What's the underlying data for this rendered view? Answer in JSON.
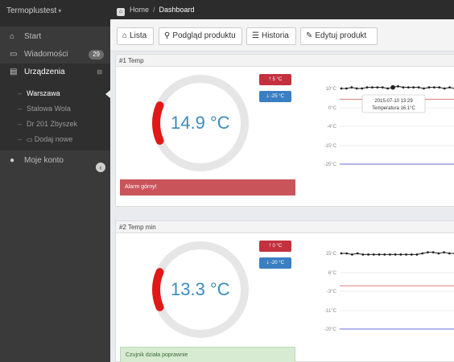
{
  "app": {
    "brand": "Termoplustest",
    "caret": "▾"
  },
  "sidebar": {
    "items": [
      {
        "label": "Start",
        "icon": "home-icon"
      },
      {
        "label": "Wiadomości",
        "icon": "inbox-icon",
        "badge": "29"
      },
      {
        "label": "Urządzenia",
        "icon": "devices-icon",
        "toggle": "⊟"
      }
    ],
    "subitems": [
      {
        "label": "Warszawa"
      },
      {
        "label": "Stalowa Wola"
      },
      {
        "label": "Dr 201 Zbyszek"
      },
      {
        "label": "Dodaj nowe"
      }
    ],
    "account": "Moje konto"
  },
  "breadcrumb": {
    "home": "Home",
    "separator": "/",
    "current": "Dashboard"
  },
  "toolbar": {
    "buttons": [
      {
        "label": "Lista",
        "icon": "home-icon",
        "glyph": "⌂"
      },
      {
        "label": "Podgląd produktu",
        "icon": "search-icon",
        "glyph": "⚲"
      },
      {
        "label": "Historia",
        "icon": "list-icon",
        "glyph": "☰"
      },
      {
        "label": "Edytuj produkt",
        "icon": "edit-icon",
        "glyph": "✎"
      }
    ]
  },
  "panels": [
    {
      "title": "#1 Temp",
      "value": "14.9 °C",
      "max_label": "5 °C",
      "min_label": "-25 °C",
      "status": "Alarm górny!",
      "status_type": "danger",
      "gauge_fraction": 0.13
    },
    {
      "title": "#2 Temp min",
      "value": "13.3 °C",
      "max_label": "0 °C",
      "min_label": "-20 °C",
      "status": "Czujnik działa poprawnie",
      "status_type": "ok",
      "gauge_fraction": 0.13
    }
  ],
  "colors": {
    "accent": "#3c8dbc",
    "gauge_fill": "#e01818",
    "gauge_track": "#e6e6e6",
    "alarm": "#c9545a",
    "ok": "#d6ebd1"
  },
  "chart_data": [
    {
      "type": "line",
      "ytick_labels": [
        "10°C",
        "0°C",
        "-4°C",
        "-15°C",
        "-25°C"
      ],
      "series": [
        {
          "values": [
            10,
            10,
            10.5,
            10,
            10,
            10.5,
            10.5,
            10.5,
            10.5,
            10,
            10.5,
            11,
            10.5,
            10.5,
            10.5,
            10.5,
            10,
            10.5,
            10.5,
            10.5,
            10,
            10.5,
            10
          ]
        }
      ],
      "upper_limit": 5,
      "lower_limit": -25,
      "tooltip": {
        "date": "2015-07-10 13:29",
        "text": "Temperatura  16.1°C"
      }
    },
    {
      "type": "line",
      "ytick_labels": [
        "15°C",
        "6°C",
        "-3°C",
        "-11°C",
        "-20°C"
      ],
      "series": [
        {
          "values": [
            15,
            15,
            14.5,
            15,
            14.5,
            14.5,
            14.5,
            14.5,
            14.5,
            14.5,
            14.5,
            14.5,
            14.5,
            14.5,
            14.5,
            15,
            15.5,
            15.5,
            15,
            15.5,
            15,
            15
          ]
        }
      ],
      "upper_limit": 0,
      "lower_limit": -20
    }
  ]
}
